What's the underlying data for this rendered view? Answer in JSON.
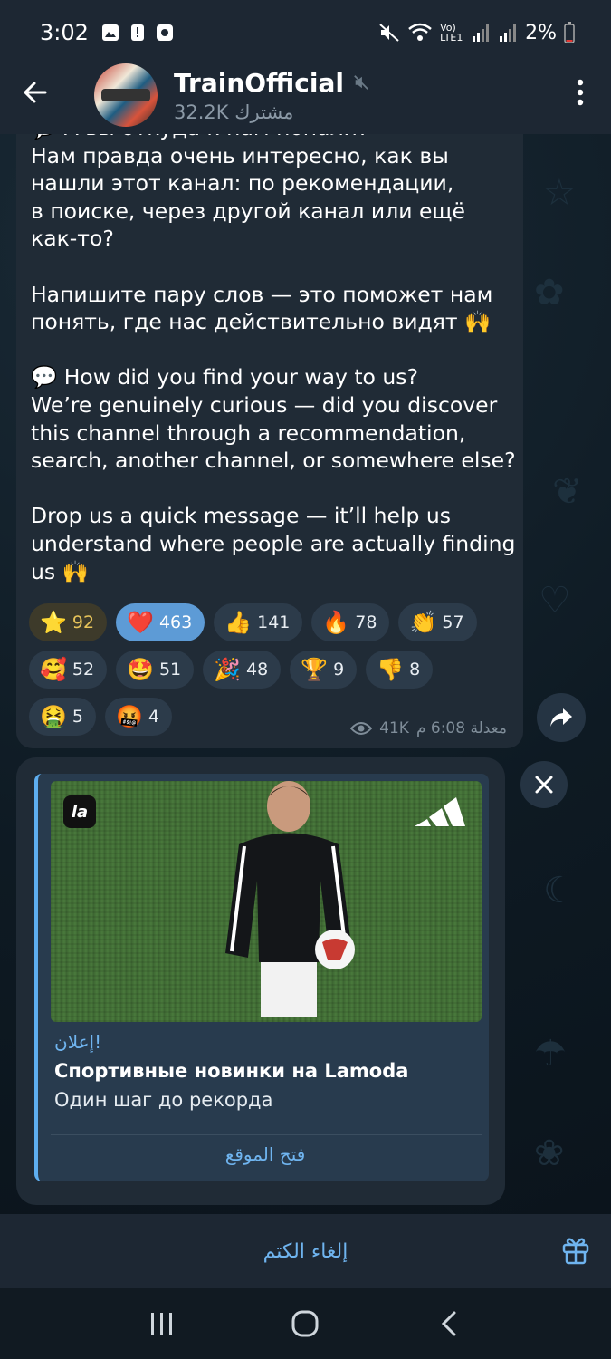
{
  "status_bar": {
    "time": "3:02",
    "network": "Vo) LTE1",
    "battery": "2%",
    "icons": [
      "gallery-icon",
      "alert-icon",
      "record-icon",
      "mute-icon",
      "wifi-icon",
      "signal-icon",
      "signal-icon",
      "battery-icon"
    ]
  },
  "header": {
    "channel_name": "TrainOfficial",
    "subscribers": "32.2K مشترك",
    "back_icon": "arrow-left-icon",
    "menu_icon": "more-vertical-icon"
  },
  "message": {
    "text": "💬 А вы откуда к нам попали?\nНам правда очень интересно, как вы\nнашли этот канал: по рекомендации,\nв поиске, через другой канал или ещё\nкак-то?\n\nНапишите пару слов — это поможет нам\nпонять, где нас действительно видят 🙌\n\n💬 How did you find your way to us?\nWe’re genuinely curious — did you discover\nthis channel through a recommendation,\nsearch, another channel, or somewhere else?\n\nDrop us a quick message — it’ll help us\nunderstand where people are actually finding\nus 🙌",
    "reactions": [
      {
        "emoji": "⭐",
        "count": "92"
      },
      {
        "emoji": "❤️",
        "count": "463"
      },
      {
        "emoji": "👍",
        "count": "141"
      },
      {
        "emoji": "🔥",
        "count": "78"
      },
      {
        "emoji": "👏",
        "count": "57"
      },
      {
        "emoji": "🥰",
        "count": "52"
      },
      {
        "emoji": "🤩",
        "count": "51"
      },
      {
        "emoji": "🎉",
        "count": "48"
      },
      {
        "emoji": "🏆",
        "count": "9"
      },
      {
        "emoji": "👎",
        "count": "8"
      },
      {
        "emoji": "🤮",
        "count": "5"
      },
      {
        "emoji": "🤬",
        "count": "4"
      }
    ],
    "views": "41K",
    "time": "معدلة 6:08 م"
  },
  "ad": {
    "label": "إعلان!",
    "title": "Спортивные новинки на Lamoda",
    "description": "Один шаг до рекорда",
    "cta": "فتح الموقع",
    "logo_text": "la"
  },
  "bottom": {
    "unmute_label": "إلغاء الكتم"
  }
}
